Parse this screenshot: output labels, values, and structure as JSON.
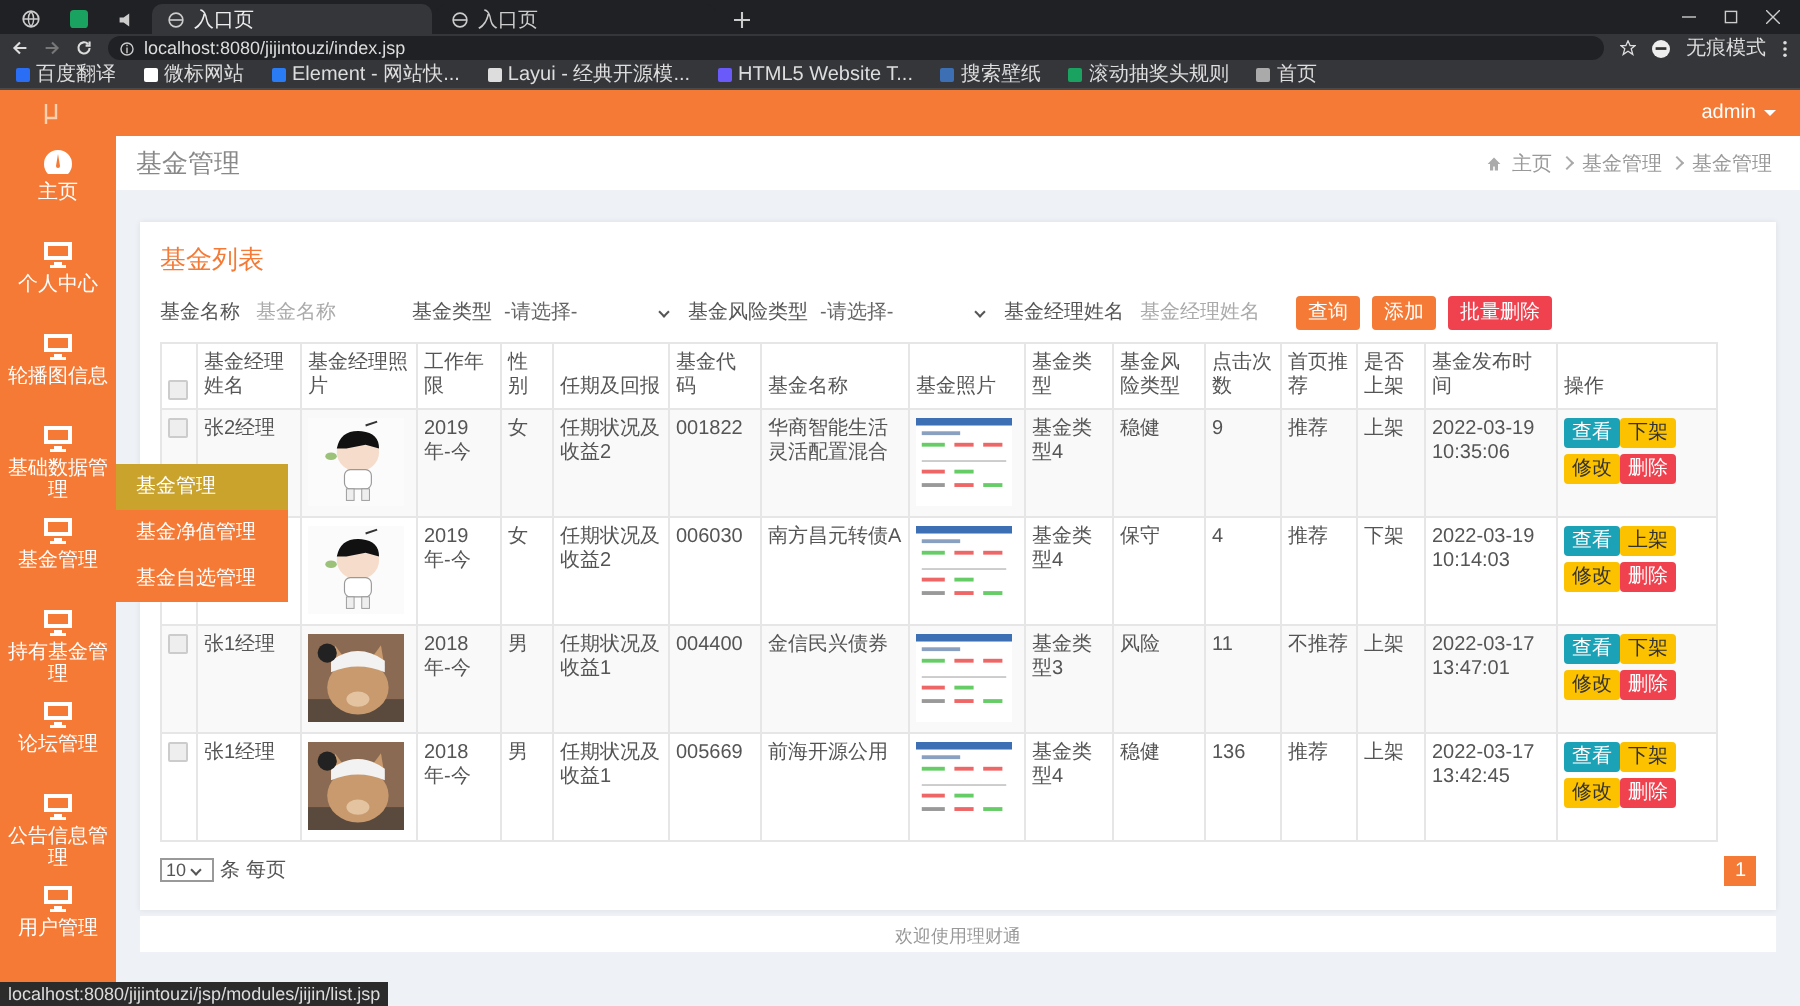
{
  "browser": {
    "tabs": [
      {
        "title": "入口页",
        "selected": true
      },
      {
        "title": "入口页",
        "selected": false
      }
    ],
    "url": "localhost:8080/jijintouzi/index.jsp",
    "profile": "无痕模式",
    "bookmarks": [
      "百度翻译",
      "微标网站",
      "Element - 网站快...",
      "Layui - 经典开源模...",
      "HTML5 Website T...",
      "搜索壁纸",
      "滚动抽奖头规则",
      "首页"
    ],
    "status_url": "localhost:8080/jijintouzi/jsp/modules/jijin/list.jsp"
  },
  "header": {
    "user": "admin"
  },
  "sidebar": {
    "items": [
      "主页",
      "个人中心",
      "轮播图信息",
      "基础数据管理",
      "基金管理",
      "持有基金管理",
      "论坛管理",
      "公告信息管理",
      "用户管理"
    ]
  },
  "submenu": [
    {
      "label": "基金管理",
      "selected": true
    },
    {
      "label": "基金净值管理",
      "selected": false
    },
    {
      "label": "基金自选管理",
      "selected": false
    }
  ],
  "page": {
    "title": "基金管理",
    "breadcrumb": [
      "主页",
      "基金管理",
      "基金管理"
    ]
  },
  "card": {
    "title": "基金列表",
    "filters": [
      {
        "kind": "input",
        "label": "基金名称",
        "placeholder": "基金名称"
      },
      {
        "kind": "select",
        "label": "基金类型",
        "value": "-请选择-"
      },
      {
        "kind": "select",
        "label": "基金风险类型",
        "value": "-请选择-"
      },
      {
        "kind": "input",
        "label": "基金经理姓名",
        "placeholder": "基金经理姓名"
      }
    ],
    "actions": [
      {
        "label": "查询",
        "kind": "primary"
      },
      {
        "label": "添加",
        "kind": "primary"
      },
      {
        "label": "批量删除",
        "kind": "danger"
      }
    ]
  },
  "table": {
    "header_checked": false,
    "columns": [
      "基金经理姓名",
      "基金经理照片",
      "工作年限",
      "性别",
      "任期及回报",
      "基金代码",
      "基金名称",
      "基金照片",
      "基金类型",
      "基金风险类型",
      "点击次数",
      "首页推荐",
      "是否上架",
      "基金发布时间",
      "操作"
    ],
    "rows": [
      {
        "checked": false,
        "name": "张2经理",
        "years": "2019年-今",
        "gender": "女",
        "tenure": "任期状况及收益2",
        "code": "001822",
        "fund": "华商智能生活灵活配置混合",
        "type": "基金类型4",
        "risk": "稳健",
        "clicks": "9",
        "recommend": "推荐",
        "shelf": "上架",
        "time": "2022-03-19 10:35:06",
        "buttons": [
          {
            "label": "查看",
            "kind": "view"
          },
          {
            "label": "下架",
            "kind": "warn"
          },
          {
            "label": "修改",
            "kind": "warn"
          },
          {
            "label": "删除",
            "kind": "delete"
          }
        ]
      },
      {
        "years": "2019年-今",
        "gender": "女",
        "tenure": "任期状况及收益2",
        "code": "006030",
        "fund": "南方昌元转债A",
        "type": "基金类型4",
        "risk": "保守",
        "clicks": "4",
        "recommend": "推荐",
        "shelf": "下架",
        "time": "2022-03-19 10:14:03",
        "buttons": [
          {
            "label": "查看",
            "kind": "view"
          },
          {
            "label": "上架",
            "kind": "warn"
          },
          {
            "label": "修改",
            "kind": "warn"
          },
          {
            "label": "删除",
            "kind": "delete"
          }
        ]
      },
      {
        "checked": false,
        "name": "张1经理",
        "years": "2018年-今",
        "gender": "男",
        "tenure": "任期状况及收益1",
        "code": "004400",
        "fund": "金信民兴债券",
        "type": "基金类型3",
        "risk": "风险",
        "clicks": "11",
        "recommend": "不推荐",
        "shelf": "上架",
        "time": "2022-03-17 13:47:01",
        "buttons": [
          {
            "label": "查看",
            "kind": "view"
          },
          {
            "label": "下架",
            "kind": "warn"
          },
          {
            "label": "修改",
            "kind": "warn"
          },
          {
            "label": "删除",
            "kind": "delete"
          }
        ]
      },
      {
        "checked": false,
        "name": "张1经理",
        "years": "2018年-今",
        "gender": "男",
        "tenure": "任期状况及收益1",
        "code": "005669",
        "fund": "前海开源公用",
        "type": "基金类型4",
        "risk": "稳健",
        "clicks": "136",
        "recommend": "推荐",
        "shelf": "上架",
        "time": "2022-03-17 13:42:45",
        "buttons": [
          {
            "label": "查看",
            "kind": "view"
          },
          {
            "label": "下架",
            "kind": "warn"
          },
          {
            "label": "修改",
            "kind": "warn"
          },
          {
            "label": "删除",
            "kind": "delete"
          }
        ]
      }
    ]
  },
  "pagination": {
    "page_size": "10",
    "page_size_suffix": "条 每页",
    "pages": [
      {
        "label": "1",
        "selected": true
      }
    ]
  },
  "footer": "欢迎使用理财通"
}
